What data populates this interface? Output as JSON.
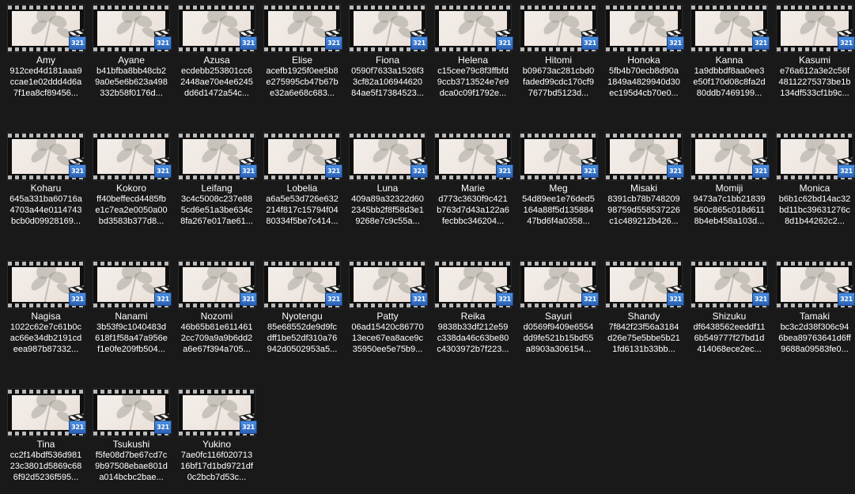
{
  "explorer": {
    "badge_text": "321",
    "files": [
      {
        "name": "Amy",
        "hash": "912ced4d181aaa9ccae1e02ddd4d6a7f1ea8cf89456..."
      },
      {
        "name": "Ayane",
        "hash": "b41bfba8bb48cb29a0e5e6b623a498332b58f0176d..."
      },
      {
        "name": "Azusa",
        "hash": "ecdebb253801cc62448ae70e4e6245dd6d1472a54c..."
      },
      {
        "name": "Elise",
        "hash": "acefb1925f0ee5b8e275995cb47b67be32a6e68c683..."
      },
      {
        "name": "Fiona",
        "hash": "0590f7633a1526f33cf82a10694462084ae5f17384523..."
      },
      {
        "name": "Helena",
        "hash": "c15cee79c8f3ffbfd9ccb3713524e7e9dca0c09f1792e..."
      },
      {
        "name": "Hitomi",
        "hash": "b09673ac281cbd0faded99cdc170cf97677bd5123d..."
      },
      {
        "name": "Honoka",
        "hash": "5fb4b70ecb8d90a1849a4829940d30ec195d4cb70e0..."
      },
      {
        "name": "Kanna",
        "hash": "1a9dbbdf8aa0ee3e50f170d08c8fa2d80ddb7469199..."
      },
      {
        "name": "Kasumi",
        "hash": "e76a612a3e2c56f48112275373be1b134df533cf1b9c..."
      },
      {
        "name": "Koharu",
        "hash": "645a331ba60716a4703a44e0114743bcb0d09928169..."
      },
      {
        "name": "Kokoro",
        "hash": "ff40beffecd4485fbe1c7ea2e0050a00bd3583b377d8..."
      },
      {
        "name": "Leifang",
        "hash": "3c4c5008c237e885cd6e51a3be634c8fa267e017ae61..."
      },
      {
        "name": "Lobelia",
        "hash": "a6a5e53d726e632214f817c15794f0480334f5be7c414..."
      },
      {
        "name": "Luna",
        "hash": "409a89a32322d602345bb2f8f58d3e19268e7c9c55a..."
      },
      {
        "name": "Marie",
        "hash": "d773c3630f9c421b763d7d43a122a6fecbbc346204..."
      },
      {
        "name": "Meg",
        "hash": "54d89ee1e76ded5164a88f5d13588447bd6f4a0358..."
      },
      {
        "name": "Misaki",
        "hash": "8391cb78b74820998759d558537226c1c489212b426..."
      },
      {
        "name": "Momiji",
        "hash": "9473a7c1bb21839560c865c018d6118b4eb458a103d..."
      },
      {
        "name": "Monica",
        "hash": "b6b1c62bd14ac32bd11bc39631276c8d1b44262c2..."
      },
      {
        "name": "Nagisa",
        "hash": "1022c62e7c61b0cac66e34db2191cdeea987b87332..."
      },
      {
        "name": "Nanami",
        "hash": "3b53f9c1040483d618f1f58a47a956ef1e0fe209fb504..."
      },
      {
        "name": "Nozomi",
        "hash": "46b65b81e6114612cc709a9a9b6dd2a6e67f394a705..."
      },
      {
        "name": "Nyotengu",
        "hash": "85e68552de9d9fcdff1be52df310a76942d0502953a5..."
      },
      {
        "name": "Patty",
        "hash": "06ad15420c8677013ece67ea8ace9c35950ee5e75b9..."
      },
      {
        "name": "Reika",
        "hash": "9838b33df212e59c338da46c63be80c4303972b7f223..."
      },
      {
        "name": "Sayuri",
        "hash": "d0569f9409e6554dd9fe521b15bd55a8903a306154..."
      },
      {
        "name": "Shandy",
        "hash": "7f842f23f56a3184d26e75e5bbe5b211fd6131b33bb..."
      },
      {
        "name": "Shizuku",
        "hash": "df6438562eeddf116b549777f27bd1d414068ece2ec..."
      },
      {
        "name": "Tamaki",
        "hash": "bc3c2d38f306c946bea89763641d6ff9688a09583fe0..."
      },
      {
        "name": "Tina",
        "hash": "cc2f14bdf536d98123c3801d5869c686f92d5236f595..."
      },
      {
        "name": "Tsukushi",
        "hash": "f5fe08d7be67cd7c9b97508ebae801da014bcbc2bae..."
      },
      {
        "name": "Yukino",
        "hash": "7ae0fc116f02071316bf17d1bd9721df0c2bcb7d53c..."
      }
    ]
  }
}
